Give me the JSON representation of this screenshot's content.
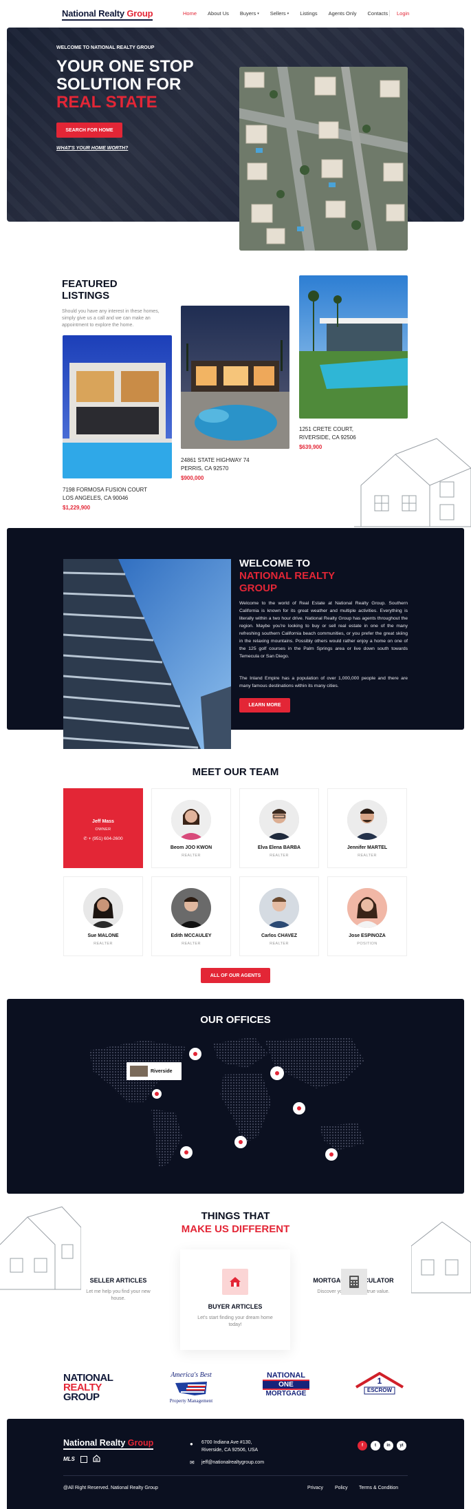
{
  "nav": {
    "logo_main": "National Realty",
    "logo_accent": "Group",
    "items": [
      "Home",
      "About Us",
      "Buyers",
      "Sellers",
      "Listings",
      "Agents Only",
      "Contacts"
    ],
    "login": "Login"
  },
  "hero": {
    "welcome": "WELCOME TO NATIONAL REALTY GROUP",
    "title_line1": "YOUR ONE STOP",
    "title_line2": "SOLUTION FOR",
    "title_accent": "REAL STATE",
    "button": "SEARCH FOR HOME",
    "link": "WHAT'S YOUR HOME WORTH?"
  },
  "featured": {
    "title_line1": "FEATURED",
    "title_line2": "LISTINGS",
    "description": "Should you have any interest in these homes, simply give us a call and we can make an appointment to explore the home.",
    "listings": [
      {
        "line1": "7198 FORMOSA FUSION COURT",
        "line2": "LOS ANGELES, CA 90046",
        "price": "$1,229,900"
      },
      {
        "line1": "24861 STATE HIGHWAY 74",
        "line2": "PERRIS, CA 92570",
        "price": "$900,000"
      },
      {
        "line1": "1251 CRETE COURT,",
        "line2": "RIVERSIDE, CA 92506",
        "price": "$639,900"
      }
    ]
  },
  "welcome": {
    "title_line1": "WELCOME TO",
    "title_accent_line1": "NATIONAL REALTY",
    "title_accent_line2": "GROUP",
    "para1": "Welcome to the world of Real Estate at National Realty Group. Southern California is known for its great weather and multiple activities. Everything is literally within a two hour drive. National Realty Group has agents throughout the region. Maybe you're looking to buy or sell real estate in one of the many refreshing southern California beach communities, or you prefer the great skiing in the relaxing mountains. Possibly others would rather enjoy a home on one of the 125 golf courses in the Palm Springs area or live down south towards Temecula or San Diego.",
    "para2": "The Inland Empire has a population of over 1,000,000 people and there are many famous destinations within its many cities.",
    "button": "LEARN MORE"
  },
  "team": {
    "title": "MEET OUR TEAM",
    "owner": {
      "name": "Jeff Mass",
      "role": "OWNER",
      "phone": "+ (951) 604-2600"
    },
    "members": [
      {
        "name": "Beom JOO KWON",
        "role": "REALTER"
      },
      {
        "name": "Elva Elena BARBA",
        "role": "REALTER"
      },
      {
        "name": "Jennifer MARTEL",
        "role": "REALTER"
      },
      {
        "name": "Sue MALONE",
        "role": "REALTER"
      },
      {
        "name": "Edith MCCAULEY",
        "role": "REALTER"
      },
      {
        "name": "Carlos CHAVEZ",
        "role": "REALTER"
      },
      {
        "name": "Jose ESPINOZA",
        "role": "POSITION"
      }
    ],
    "button": "ALL OF OUR AGENTS"
  },
  "offices": {
    "title": "OUR OFFICES",
    "popup_label": "Riverside"
  },
  "different": {
    "title_line1": "THINGS THAT",
    "title_accent": "MAKE US DIFFERENT",
    "cards": [
      {
        "title": "SELLER ARTICLES",
        "desc": "Let me help you find your new house."
      },
      {
        "title": "BUYER ARTICLES",
        "desc": "Let's start finding your dream home today!"
      },
      {
        "title": "MORTGAGE CALCULATOR",
        "desc": "Discover your homes's true value."
      }
    ]
  },
  "partners": {
    "nrg": [
      "NATIONAL",
      "REALTY",
      "GROUP"
    ],
    "americas_best_top": "America's Best",
    "americas_best_bottom": "Property Management",
    "national_one": [
      "NATIONAL",
      "ONE",
      "MORTGAGE"
    ],
    "escrow": "ESCROW",
    "escrow_number": "1"
  },
  "footer": {
    "logo_main": "National Realty",
    "logo_accent": "Group",
    "mls": "MLS",
    "address_line1": "6700 Indiana Ave #130,",
    "address_line2": "Riverside, CA 92506, USA",
    "email": "jeff@nationalrealtygroup.com",
    "copyright": "@All Right Reserved. National Realty Group",
    "links": [
      "Privacy",
      "Policy",
      "Terms & Condition"
    ],
    "social": [
      "f",
      "t",
      "in",
      "yt"
    ]
  },
  "colors": {
    "accent": "#e32636",
    "navy": "#0b1020"
  }
}
